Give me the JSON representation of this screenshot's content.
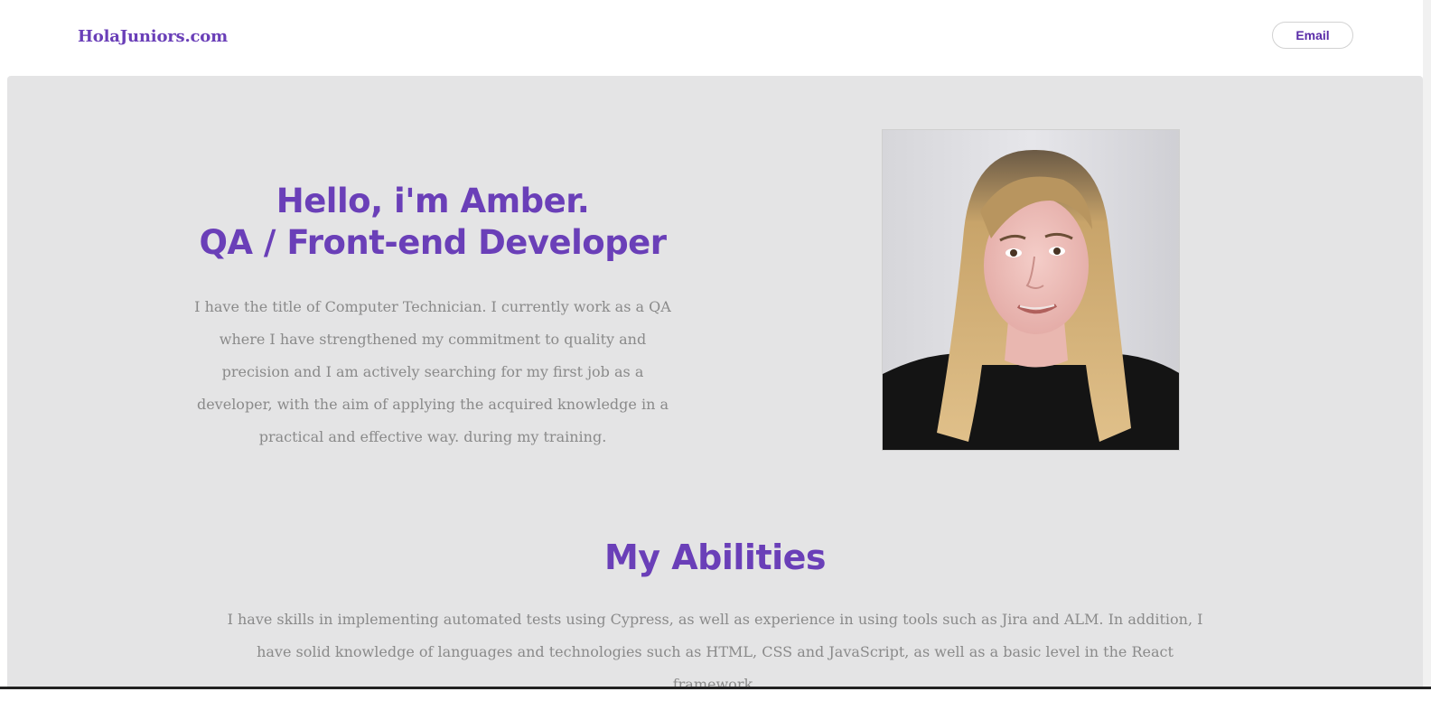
{
  "header": {
    "brand": "HolaJuniors.com",
    "email_button": "Email"
  },
  "hero": {
    "title_line1": "Hello, i'm Amber.",
    "title_line2": "QA / Front-end Developer",
    "description": "I have the title of Computer Technician. I currently work as a QA where I have strengthened my commitment to quality and precision and I am actively searching for my first job as a developer, with the aim of applying the acquired knowledge in a practical and effective way. during my training."
  },
  "abilities": {
    "title": "My Abilities",
    "description": "I have skills in implementing automated tests using Cypress, as well as experience in using tools such as Jira and ALM. In addition, I have solid knowledge of languages and technologies such as HTML, CSS and JavaScript, as well as a basic level in the React framework."
  },
  "colors": {
    "accent": "#6a3fb8",
    "section_bg": "#e4e4e5",
    "body_text": "#8a8a8a"
  }
}
